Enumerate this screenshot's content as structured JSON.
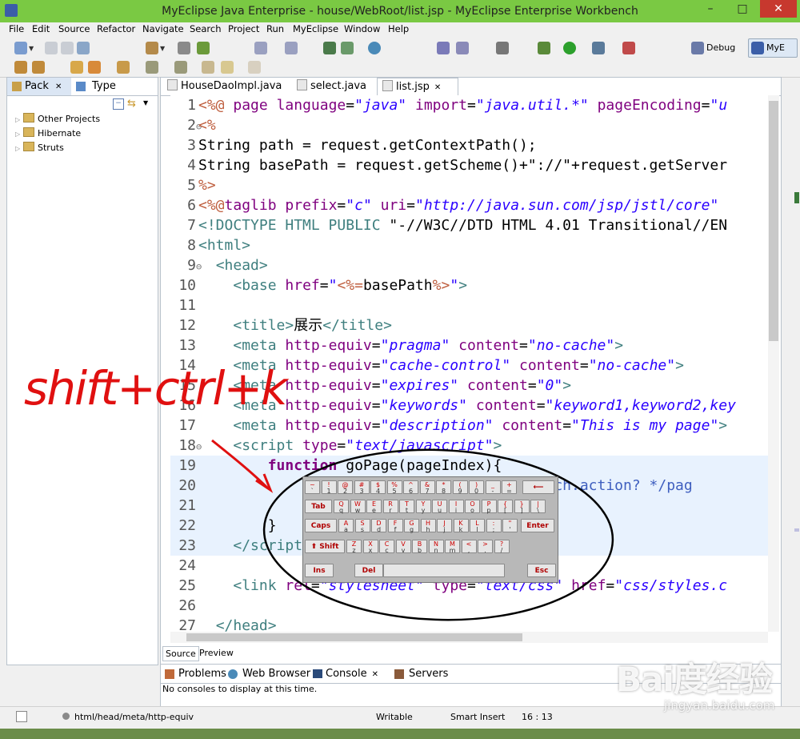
{
  "window": {
    "title": "MyEclipse Java Enterprise - house/WebRoot/list.jsp - MyEclipse Enterprise Workbench",
    "min": "–",
    "max": "□",
    "close": "✕"
  },
  "menu": [
    "File",
    "Edit",
    "Source",
    "Refactor",
    "Navigate",
    "Search",
    "Project",
    "Run",
    "MyEclipse",
    "Window",
    "Help"
  ],
  "perspectives": {
    "debug": "Debug",
    "myeclipse": "MyE"
  },
  "left_panel": {
    "tabs": [
      "Pack",
      "Type"
    ],
    "tree": [
      "Other Projects",
      "Hibernate",
      "Struts"
    ]
  },
  "editor": {
    "tabs": [
      "HouseDaoImpl.java",
      "select.java",
      "list.jsp"
    ],
    "bottom_tabs": [
      "Source",
      "Preview"
    ],
    "lines": [
      {
        "n": "1",
        "fold": "",
        "html": "<span class='d'>&lt;%@</span> <span class='k'>page</span> <span class='k'>language</span>=<span class='s'>\"java\"</span> <span class='k'>import</span>=<span class='s'>\"java.util.*\"</span> <span class='k'>pageEncoding</span>=<span class='s'>\"u</span>"
      },
      {
        "n": "2",
        "fold": "⊖",
        "html": "<span class='d'>&lt;%</span>"
      },
      {
        "n": "3",
        "fold": "",
        "html": "String path = request.getContextPath();"
      },
      {
        "n": "4",
        "fold": "",
        "html": "String basePath = request.getScheme()+\"://\"+request.getServer"
      },
      {
        "n": "5",
        "fold": "",
        "html": "<span class='d'>%&gt;</span>"
      },
      {
        "n": "6",
        "fold": "",
        "html": "<span class='d'>&lt;%@</span><span class='k'>taglib</span> <span class='k'>prefix</span>=<span class='s'>\"c\"</span> <span class='k'>uri</span>=<span class='s'>\"http://java.sun.com/jsp/jstl/core\"</span> "
      },
      {
        "n": "7",
        "fold": "",
        "html": "<span class='t'>&lt;!DOCTYPE HTML PUBLIC</span> \"-//W3C//DTD HTML 4.01 Transitional//EN"
      },
      {
        "n": "8",
        "fold": "",
        "html": "<span class='t'>&lt;html&gt;</span>"
      },
      {
        "n": "9",
        "fold": "⊖",
        "html": "  <span class='t'>&lt;head&gt;</span>"
      },
      {
        "n": "10",
        "fold": "",
        "html": "    <span class='t'>&lt;base</span> <span class='k'>href</span>=<span class='s' style='font-style:normal'>\"</span><span class='d'>&lt;%=</span>basePath<span class='d'>%&gt;</span><span class='s' style='font-style:normal'>\"</span><span class='t'>&gt;</span>"
      },
      {
        "n": "11",
        "fold": "",
        "html": ""
      },
      {
        "n": "12",
        "fold": "",
        "html": "    <span class='t'>&lt;title&gt;</span>展示<span class='t'>&lt;/title&gt;</span>"
      },
      {
        "n": "13",
        "fold": "",
        "html": "    <span class='t'>&lt;meta</span> <span class='k'>http-equiv</span>=<span class='s'>\"pragma\"</span> <span class='k'>content</span>=<span class='s'>\"no-cache\"</span><span class='t'>&gt;</span>"
      },
      {
        "n": "14",
        "fold": "",
        "html": "    <span class='t'>&lt;meta</span> <span class='k'>http-equiv</span>=<span class='s'>\"cache-control\"</span> <span class='k'>content</span>=<span class='s'>\"no-cache\"</span><span class='t'>&gt;</span>"
      },
      {
        "n": "15",
        "fold": "",
        "html": "    <span class='t'>&lt;meta</span> <span class='k'>http-equiv</span>=<span class='s'>\"expires\"</span> <span class='k'>content</span>=<span class='s'>\"0\"</span><span class='t'>&gt;</span>"
      },
      {
        "n": "16",
        "fold": "",
        "html": "    <span class='t'>&lt;meta</span> <span class='k'>http-equiv</span>=<span class='s'>\"keywords\"</span> <span class='k'>content</span>=<span class='s'>\"keyword1,keyword2,key</span>"
      },
      {
        "n": "17",
        "fold": "",
        "html": "    <span class='t'>&lt;meta</span> <span class='k'>http-equiv</span>=<span class='s'>\"description\"</span> <span class='k'>content</span>=<span class='s'>\"This is my page\"</span><span class='t'>&gt;</span>"
      },
      {
        "n": "18",
        "fold": "⊖",
        "html": "    <span class='t'>&lt;script</span> <span class='k'>type</span>=<span class='s'>\"text/javascript\"</span><span class='t'>&gt;</span>"
      },
      {
        "n": "19",
        "fold": "",
        "html": "        <span class='k' style='font-weight:bold'>function</span> goPage(pageIndex){"
      },
      {
        "n": "20",
        "fold": "",
        "html": "                                  <span class='c'>/* search.action? */pag</span>"
      },
      {
        "n": "21",
        "fold": "",
        "html": ""
      },
      {
        "n": "22",
        "fold": "",
        "html": "        }"
      },
      {
        "n": "23",
        "fold": "",
        "html": "    <span class='t'>&lt;/script&gt;</span>"
      },
      {
        "n": "24",
        "fold": "",
        "html": ""
      },
      {
        "n": "25",
        "fold": "",
        "html": "    <span class='t'>&lt;link</span> <span class='k'>rel</span>=<span class='s'>\"stylesheet\"</span> <span class='k'>type</span>=<span class='s'>\"text/css\"</span> <span class='k'>href</span>=<span class='s'>\"css/styles.c</span>"
      },
      {
        "n": "26",
        "fold": "",
        "html": ""
      },
      {
        "n": "27",
        "fold": "",
        "html": "  <span class='t'>&lt;/head&gt;</span>"
      }
    ]
  },
  "console": {
    "tabs": [
      "Problems",
      "Web Browser",
      "Console",
      "Servers"
    ],
    "message": "No consoles to display at this time."
  },
  "status": {
    "path": "html/head/meta/http-equiv",
    "mode": "Writable",
    "insert": "Smart Insert",
    "position": "16 : 13"
  },
  "keyboard": {
    "row1": [
      [
        "~",
        "`"
      ],
      [
        "!",
        "1"
      ],
      [
        "@",
        "2"
      ],
      [
        "#",
        "3"
      ],
      [
        "$",
        "4"
      ],
      [
        "%",
        "5"
      ],
      [
        "^",
        "6"
      ],
      [
        "&",
        "7"
      ],
      [
        "*",
        "8"
      ],
      [
        "(",
        "9"
      ],
      [
        ")",
        "0"
      ],
      [
        "_",
        "-"
      ],
      [
        "+",
        "="
      ]
    ],
    "row2": [
      [
        "Q",
        "q"
      ],
      [
        "W",
        "w"
      ],
      [
        "E",
        "e"
      ],
      [
        "R",
        "r"
      ],
      [
        "T",
        "t"
      ],
      [
        "Y",
        "y"
      ],
      [
        "U",
        "u"
      ],
      [
        "I",
        "i"
      ],
      [
        "O",
        "o"
      ],
      [
        "P",
        "p"
      ],
      [
        "{",
        "["
      ],
      [
        "}",
        "]"
      ],
      [
        "|",
        "\\"
      ]
    ],
    "row3": [
      [
        "A",
        "a"
      ],
      [
        "S",
        "s"
      ],
      [
        "D",
        "d"
      ],
      [
        "F",
        "f"
      ],
      [
        "G",
        "g"
      ],
      [
        "H",
        "h"
      ],
      [
        "J",
        "j"
      ],
      [
        "K",
        "k"
      ],
      [
        "L",
        "l"
      ],
      [
        ":",
        ";"
      ],
      [
        "\"",
        "'"
      ]
    ],
    "row4": [
      [
        "Z",
        "z"
      ],
      [
        "X",
        "x"
      ],
      [
        "C",
        "c"
      ],
      [
        "V",
        "v"
      ],
      [
        "B",
        "b"
      ],
      [
        "N",
        "n"
      ],
      [
        "M",
        "m"
      ],
      [
        "<",
        ","
      ],
      [
        ">",
        "."
      ],
      [
        "?",
        "/"
      ]
    ],
    "tab": "Tab",
    "caps": "Caps",
    "enter": "Enter",
    "shift": "Shift",
    "ins": "Ins",
    "del": "Del",
    "esc": "Esc",
    "backspace": "⟵"
  },
  "annotation": {
    "text": "shift+ctrl+k",
    "color": "#e01010"
  },
  "watermark": {
    "logo": "Bai度经验",
    "url": "jingyan.baidu.com"
  }
}
